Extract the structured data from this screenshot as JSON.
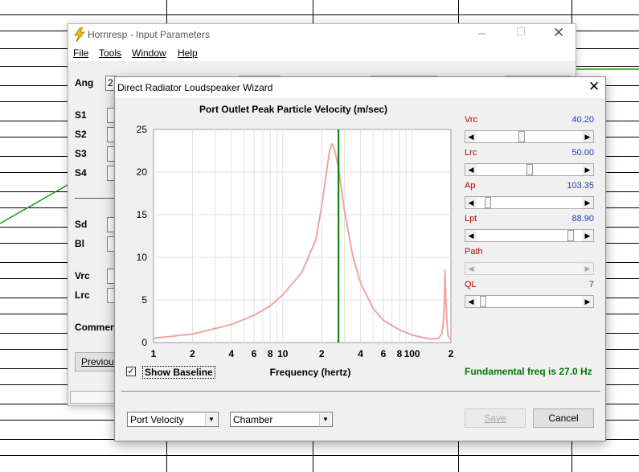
{
  "bg_window": {
    "title": "Hornresp - Input Parameters",
    "menu": [
      "File",
      "Tools",
      "Window",
      "Help"
    ],
    "labels": [
      "Ang",
      "S1",
      "S2",
      "S3",
      "S4",
      "Sd",
      "Bl",
      "Vrc",
      "Lrc",
      "Comment"
    ],
    "ang_value": "2",
    "previous_label": "Previous"
  },
  "wizard": {
    "title": "Direct Radiator Loudspeaker Wizard",
    "fundamental": "Fundamental freq is 27.0 Hz",
    "show_baseline": "Show Baseline",
    "controls": [
      {
        "label": "Vrc",
        "value": "40.20",
        "pos": 0.42
      },
      {
        "label": "Lrc",
        "value": "50.00",
        "pos": 0.5
      },
      {
        "label": "Ap",
        "value": "103.35",
        "pos": 0.08
      },
      {
        "label": "Lpt",
        "value": "88.90",
        "pos": 0.92
      },
      {
        "label": "Path",
        "value": "",
        "pos": null
      },
      {
        "label": "QL",
        "value": "7",
        "pos": 0.03
      }
    ],
    "combo_left": "Port Velocity",
    "combo_right": "Chamber",
    "save_label": "Save",
    "cancel_label": "Cancel"
  },
  "chart_data": {
    "type": "line",
    "title": "Port Outlet Peak Particle Velocity (m/sec)",
    "xlabel": "Frequency (hertz)",
    "ylabel": "",
    "x_scale": "log",
    "xlim": [
      1,
      200
    ],
    "ylim": [
      0,
      25
    ],
    "yticks": [
      "0",
      "5",
      "10",
      "15",
      "20",
      "25"
    ],
    "xticks": [
      "1",
      "2",
      "4",
      "6",
      "8",
      "10",
      "2",
      "4",
      "6",
      "8",
      "100",
      "2"
    ],
    "marker_freq": 27.0,
    "grid": true,
    "series": [
      {
        "color": "#f4a3a3",
        "x": [
          1,
          2,
          4,
          6,
          8,
          10,
          14,
          18,
          20,
          22,
          23,
          24,
          25,
          27,
          30,
          35,
          40,
          50,
          60,
          80,
          100,
          120,
          140,
          160,
          170,
          175,
          178,
          180,
          182,
          185,
          190,
          200
        ],
        "y": [
          0.5,
          1.0,
          2.1,
          3.2,
          4.3,
          5.6,
          8.2,
          12.0,
          16.0,
          20.5,
          22.5,
          23.3,
          22.8,
          20.5,
          15.5,
          10.0,
          7.0,
          4.0,
          2.6,
          1.5,
          0.9,
          0.6,
          0.4,
          0.5,
          1.0,
          2.5,
          5.0,
          8.5,
          6.0,
          3.0,
          0.8,
          0.3
        ]
      }
    ]
  },
  "colors": {
    "marker": "#007a00",
    "label_red": "#c00000",
    "value_blue": "#1f3fb0",
    "fundamental_green": "#007a00"
  }
}
